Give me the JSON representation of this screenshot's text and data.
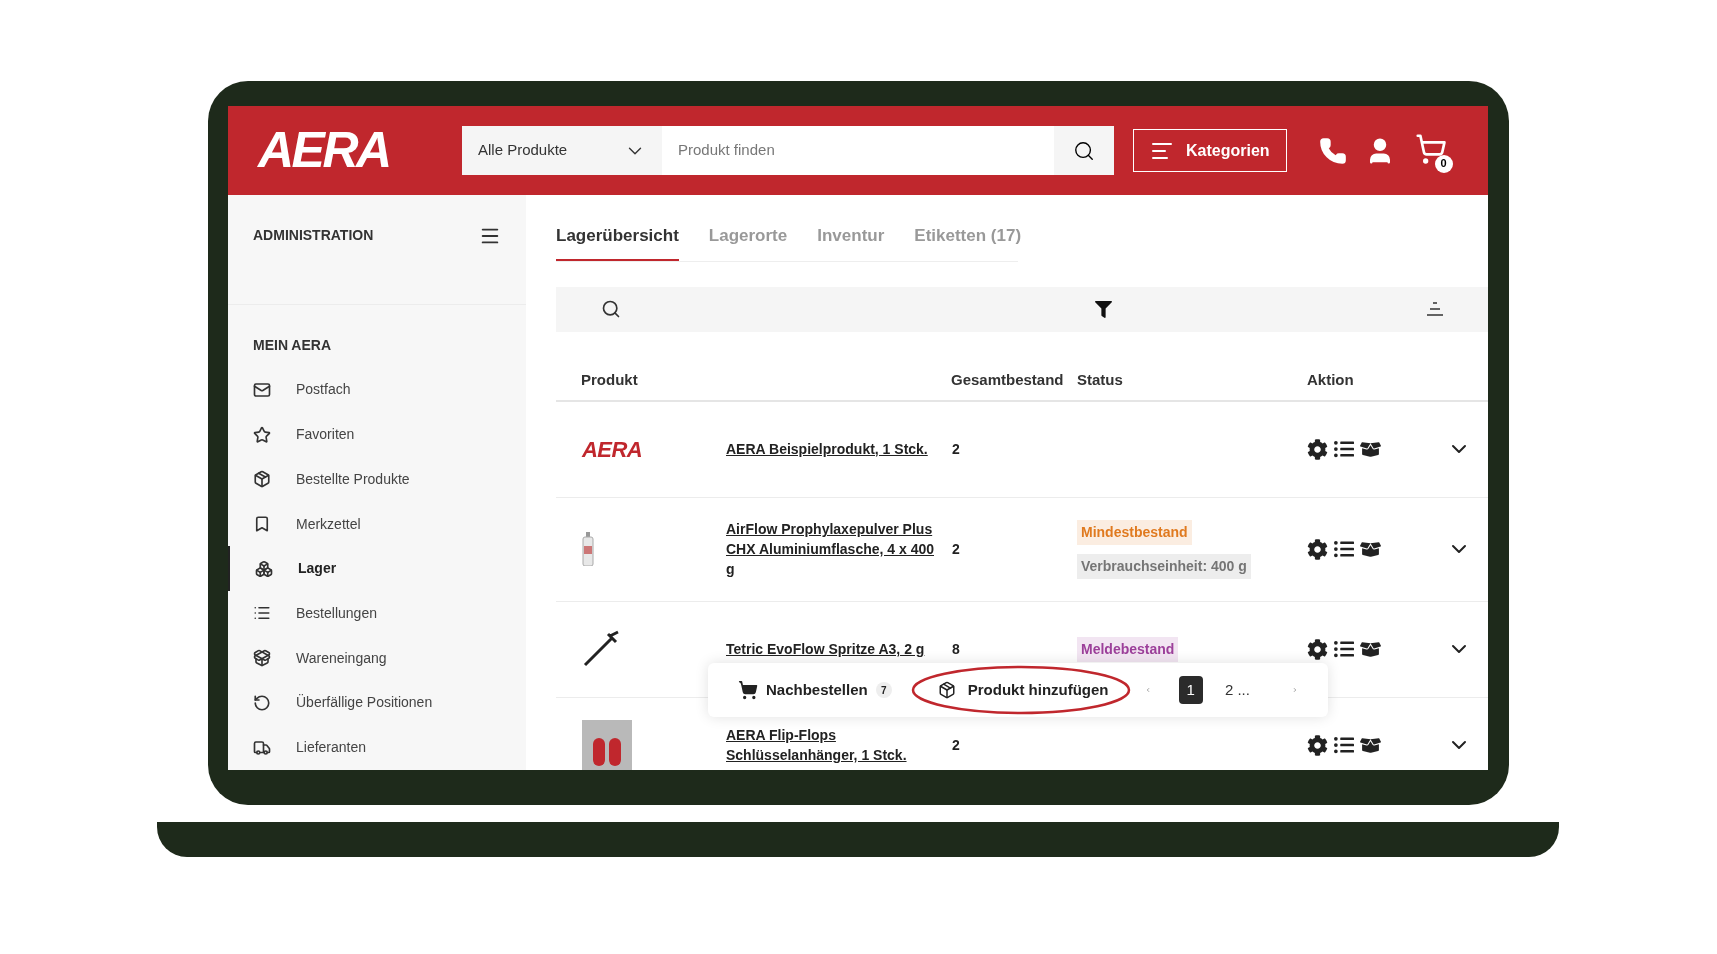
{
  "header": {
    "logo": "AERA",
    "scope_select": {
      "value": "Alle Produkte"
    },
    "search": {
      "placeholder": "Produkt finden"
    },
    "categories_button": "Kategorien",
    "cart_count": "0"
  },
  "sidebar": {
    "title": "ADMINISTRATION",
    "section": "MEIN AERA",
    "items": [
      {
        "label": "Postfach",
        "selected": false
      },
      {
        "label": "Favoriten",
        "selected": false
      },
      {
        "label": "Bestellte Produkte",
        "selected": false
      },
      {
        "label": "Merkzettel",
        "selected": false
      },
      {
        "label": "Lager",
        "selected": true
      },
      {
        "label": "Bestellungen",
        "selected": false
      },
      {
        "label": "Wareneingang",
        "selected": false
      },
      {
        "label": "Überfällige Positionen",
        "selected": false
      },
      {
        "label": "Lieferanten",
        "selected": false
      }
    ]
  },
  "tabs": [
    {
      "label": "Lagerübersicht",
      "selected": true
    },
    {
      "label": "Lagerorte",
      "selected": false
    },
    {
      "label": "Inventur",
      "selected": false
    },
    {
      "label": "Etiketten (17)",
      "selected": false
    }
  ],
  "table": {
    "columns": [
      "Produkt",
      "Gesamtbestand",
      "Status",
      "Aktion"
    ],
    "rows": [
      {
        "kind": "logo",
        "image_text": "AERA",
        "name": "AERA Beispielprodukt, 1 Stck.",
        "total": "2",
        "tags": []
      },
      {
        "kind": "bottle",
        "name": "AirFlow Prophylaxepulver Plus CHX Aluminiumflasche, 4 x 400 g",
        "total": "2",
        "tags": [
          {
            "label": "Mindestbestand",
            "color": "#e07a1f"
          },
          {
            "label": "Verbrauchseinheit: 400 g",
            "color": "#757575"
          }
        ]
      },
      {
        "kind": "syringe",
        "name": "Tetric EvoFlow Spritze A3, 2 g",
        "total": "8",
        "tags": [
          {
            "label": "Meldebestand",
            "color": "#9c3f9a"
          }
        ]
      },
      {
        "kind": "photo",
        "name": "AERA Flip-Flops Schlüsselanhänger, 1 Stck.",
        "total": "2",
        "tags": []
      }
    ]
  },
  "action_bar": {
    "reorder": {
      "label": "Nachbestellen",
      "count": "7"
    },
    "add_product": "Produkt hinzufügen",
    "pages": [
      {
        "label": "1",
        "selected": true
      },
      {
        "label": "2 ...",
        "selected": false
      }
    ]
  }
}
